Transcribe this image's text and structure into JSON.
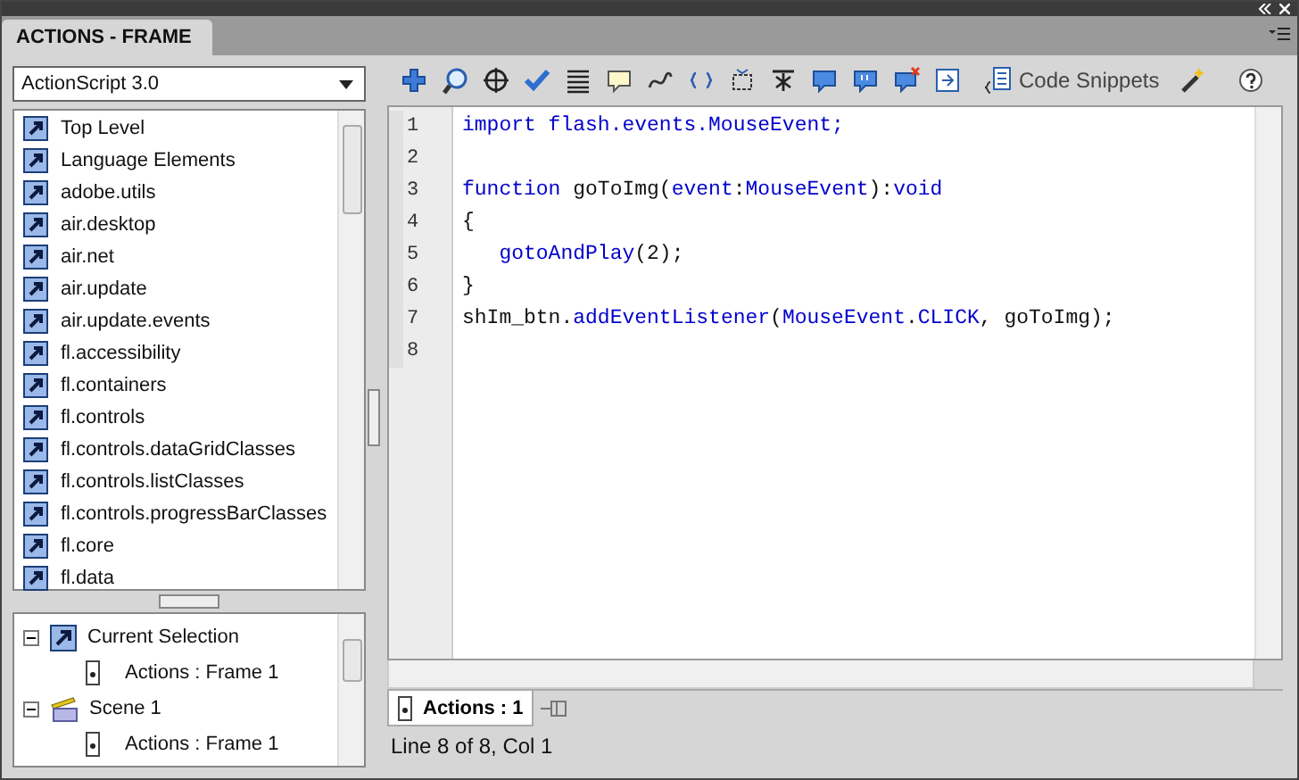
{
  "panel": {
    "title": "ACTIONS - FRAME"
  },
  "language_dropdown": {
    "value": "ActionScript 3.0"
  },
  "toolbox": {
    "items": [
      {
        "label": "Top Level"
      },
      {
        "label": "Language Elements"
      },
      {
        "label": "adobe.utils"
      },
      {
        "label": "air.desktop"
      },
      {
        "label": "air.net"
      },
      {
        "label": "air.update"
      },
      {
        "label": "air.update.events"
      },
      {
        "label": "fl.accessibility"
      },
      {
        "label": "fl.containers"
      },
      {
        "label": "fl.controls"
      },
      {
        "label": "fl.controls.dataGridClasses"
      },
      {
        "label": "fl.controls.listClasses"
      },
      {
        "label": "fl.controls.progressBarClasses"
      },
      {
        "label": "fl.core"
      },
      {
        "label": "fl.data"
      }
    ]
  },
  "script_navigator": {
    "items": [
      {
        "label": "Current Selection",
        "kind": "selection",
        "expanded": true,
        "children": [
          {
            "label": "Actions : Frame 1"
          }
        ]
      },
      {
        "label": "Scene 1",
        "kind": "scene",
        "expanded": true,
        "children": [
          {
            "label": "Actions : Frame 1"
          }
        ]
      }
    ]
  },
  "toolbar": {
    "code_snippets": "Code Snippets"
  },
  "editor": {
    "lines": [
      {
        "number": "1",
        "tokens": [
          {
            "kind": "keyword",
            "text": "import flash.events.MouseEvent;"
          }
        ]
      },
      {
        "number": "2"
      },
      {
        "number": "3",
        "tokens": [
          {
            "kind": "keyword",
            "text": "function"
          },
          {
            "kind": "plain",
            "text": " goToImg("
          },
          {
            "kind": "keyword",
            "text": "event"
          },
          {
            "kind": "plain",
            "text": ":"
          },
          {
            "kind": "keyword",
            "text": "MouseEvent"
          },
          {
            "kind": "plain",
            "text": "):"
          },
          {
            "kind": "keyword",
            "text": "void"
          }
        ]
      },
      {
        "number": "4",
        "tokens": [
          {
            "kind": "plain",
            "text": "{"
          }
        ]
      },
      {
        "number": "5",
        "indented": true,
        "tokens": [
          {
            "kind": "keyword",
            "text": "gotoAndPlay"
          },
          {
            "kind": "plain",
            "text": "(2);"
          }
        ]
      },
      {
        "number": "6",
        "tokens": [
          {
            "kind": "plain",
            "text": "}"
          }
        ]
      },
      {
        "number": "7",
        "tokens": [
          {
            "kind": "plain",
            "text": "shIm_btn."
          },
          {
            "kind": "keyword",
            "text": "addEventListener"
          },
          {
            "kind": "plain",
            "text": "("
          },
          {
            "kind": "keyword",
            "text": "MouseEvent"
          },
          {
            "kind": "plain",
            "text": "."
          },
          {
            "kind": "keyword",
            "text": "CLICK"
          },
          {
            "kind": "plain",
            "text": ", goToImg);"
          }
        ]
      },
      {
        "number": "8"
      }
    ]
  },
  "script_tabs": [
    {
      "label": "Actions : 1",
      "selected": true
    }
  ],
  "status_bar": {
    "text": "Line 8 of 8, Col 1"
  }
}
